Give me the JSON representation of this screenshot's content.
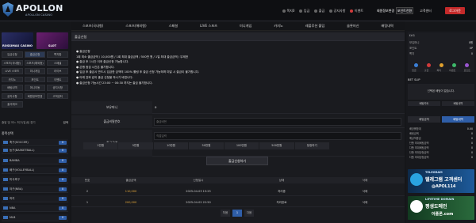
{
  "brand": {
    "name": "APOLLON",
    "sub": "APOLLON CASINO"
  },
  "top_links": [
    {
      "label": "쪽지0",
      "icon": "mail-icon"
    },
    {
      "label": "입금",
      "icon": "deposit-icon"
    },
    {
      "label": "출금",
      "icon": "withdraw-icon"
    },
    {
      "label": "공지사항",
      "icon": "notice-icon"
    },
    {
      "label": "이벤트",
      "icon": "event-icon"
    }
  ],
  "top_buttons": {
    "mypage": "회원정보변경",
    "cs": "포인트전환",
    "cs2": "고객센터",
    "logout": "로그아웃"
  },
  "nav": [
    "스포츠(국내형)",
    "스포츠(해외형)",
    "스페셜",
    "LIVE 스포츠",
    "미니게임",
    "카지노",
    "레볼루션 홀덤",
    "슬롯머신",
    "배팅내역"
  ],
  "left": {
    "promo": [
      "ROSSIMAX CASINO",
      "SLOT"
    ],
    "buttons": [
      [
        "입금신청",
        "출금신청",
        "쪽지함"
      ],
      [
        "스포츠(국내형)",
        "스포츠(해외형)",
        "스페셜"
      ],
      [
        "LIVE 스포츠",
        "미니게임",
        "라이브"
      ],
      [
        "카지노",
        "포인트",
        "이벤트"
      ],
      [
        "배팅내역",
        "머니이동",
        "공지사항"
      ],
      [
        "공지사항",
        "회원정보변경",
        "고객센터"
      ],
      [
        "출석체크"
      ]
    ],
    "notice": "출발 및 어느 최고(일)팀 경기",
    "notice_go": "검색",
    "category": "종목선택",
    "sports": [
      {
        "name": "축구(SOCCER)",
        "count": "0"
      },
      {
        "name": "농구(BASKETBALL)",
        "count": "0"
      },
      {
        "name": "BAMBA",
        "count": "0"
      },
      {
        "name": "배구(VOLLEYBALL)",
        "count": "0"
      },
      {
        "name": "미식축구",
        "count": "0"
      },
      {
        "name": "야구(NBA)",
        "count": "0"
      },
      {
        "name": "하키",
        "count": "0"
      },
      {
        "name": "NBA",
        "count": "0"
      },
      {
        "name": "MLB",
        "count": "0"
      }
    ]
  },
  "main": {
    "title": "출금신청",
    "notice_lines": [
      "● 출금신청",
      "1회 최소 출금금액 / 10,000원 / 1회 최대 출금금액 / 500만 원 / 1일 최대 출금금액 / 무제한",
      "● 출금 후 1시간 이후 출금신청 가능합니다.",
      "● 은행 점검 시간은 불가합니다.",
      "● 입금 후 출금시 반드시 입금한 금액의 100% 롤링 후 출금 신청 가능하며 미달 시 출금이 불가합니다.",
      "● 아래 표와 같이 출금 신청을 하시기 바랍니다.",
      "● 출금신청 가능시간 23:00 ~ 00:30 까지는 출금 불가합니다."
    ],
    "form": {
      "holder_label": "보유머니",
      "holder_value": "0",
      "pw_label": "출금비밀번호",
      "pw_placeholder": "출금비번",
      "amount_label": "출금금액",
      "amount_placeholder": "직접입력",
      "amount_buttons": [
        "1만원",
        "5만원",
        "10만원",
        "50만원",
        "100만원",
        "500만원",
        "정정하기"
      ],
      "submit": "출금신청하기"
    },
    "table": {
      "headers": [
        "번호",
        "출금금액",
        "신청일시",
        "상태",
        "삭제"
      ],
      "rows": [
        [
          "2",
          "110,000",
          "2025-04-03 15:25",
          "처리중",
          "삭제"
        ],
        [
          "1",
          "200,000",
          "2025-04-02 22:50",
          "처리완료",
          "삭제"
        ]
      ]
    },
    "pager": [
      "처음",
      "1",
      "다음"
    ]
  },
  "right": {
    "user": "LV.1",
    "lines": [
      {
        "label": "보유머니",
        "value": "0원"
      },
      {
        "label": "포인트",
        "value": "0P"
      },
      {
        "label": "쪽지",
        "value": "0"
      }
    ],
    "mini_buttons": [
      "로그아웃",
      "포인트전환",
      "입출금"
    ],
    "dot_labels": [
      "입금",
      "출금",
      "쪽지",
      "이벤트",
      "포인트"
    ],
    "slip_title": "BET SLIP",
    "slip_text": "선택된 배팅이 없습니다.",
    "tabs": [
      "배팅카트",
      "배팅내역"
    ],
    "tabs2": [
      "배팅금액",
      "배팅내역"
    ],
    "list": [
      {
        "label": "배당률합계",
        "value": "0.00"
      },
      {
        "label": "배팅금액",
        "value": "0"
      },
      {
        "label": "예상적중금",
        "value": "0"
      },
      {
        "label": "단폴 최대배팅금액",
        "value": "0"
      },
      {
        "label": "다폴 최대배팅금액",
        "value": "0"
      },
      {
        "label": "단폴 최대당첨금액",
        "value": "0"
      },
      {
        "label": "다폴 최대당첨금액",
        "value": "0"
      }
    ],
    "banners": [
      {
        "a": "TELEGRAM",
        "b": "텔레그램 고객센터",
        "c": "@APOL114"
      },
      {
        "a": "LIFETIME DOMAIN",
        "b": "평생도메인",
        "c": "아폴론.com"
      }
    ]
  },
  "colors": {
    "accent": "#2f5ea8",
    "danger": "#c52a2a",
    "amount": "#e7a93a"
  }
}
